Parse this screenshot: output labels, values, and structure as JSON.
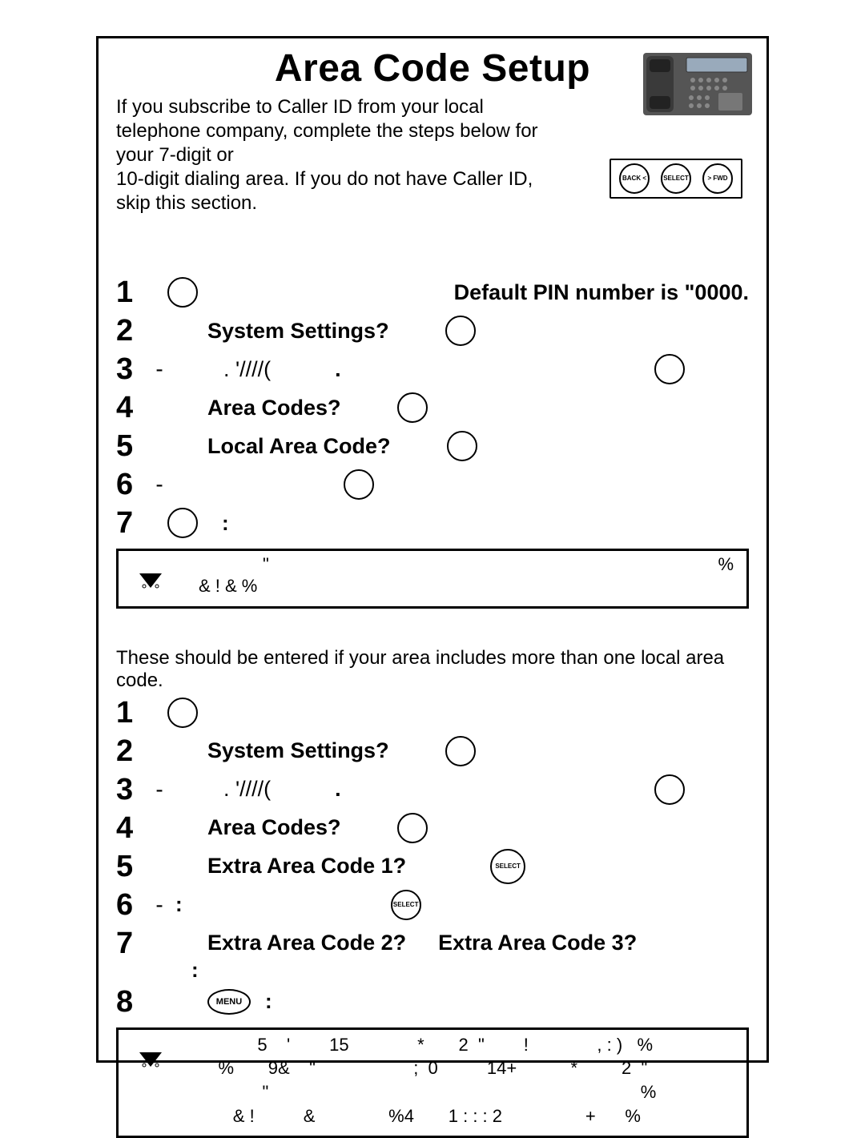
{
  "title": "Area Code Setup",
  "intro_line1": "If you subscribe to Caller ID from your local telephone company, complete the steps below for your 7-digit or",
  "intro_line2": "10-digit dialing area. If you do not have Caller ID, skip this section.",
  "buttons": {
    "back": "BACK <",
    "select": "SELECT",
    "fwd": "> FWD",
    "menu": "MENU"
  },
  "section1": {
    "step1_right": "Default PIN number is \"0000.",
    "step2": "System Settings?",
    "step3": ".  '////(",
    "step3_dot": ".",
    "step4": "Area Codes?",
    "step5": "Local Area Code?",
    "step7_colon": ":",
    "note_q": "\"",
    "note_pct": "%",
    "note_line2": "& !          &                %"
  },
  "section2": {
    "intro": "These should be entered if your area includes more than one local area code.",
    "step2": "System Settings?",
    "step3": ".  '////(",
    "step3_dot": ".",
    "step4": "Area Codes?",
    "step5": "Extra Area Code 1?",
    "step6_colon": ":",
    "step7a": "Extra Area Code 2?",
    "step7b": "Extra Area Code 3?",
    "step7_colon": ":",
    "step8_colon": ":",
    "note_line1": "            5    '        15              *       2  \"        !              , : )   %",
    "note_line2": "    %       9&    \"                    ;  0          14+           *         2  \"",
    "note_line3": "             \"                                                                            %",
    "note_line4": "       & !          &               %4       1 : : : 2                 +      %"
  }
}
